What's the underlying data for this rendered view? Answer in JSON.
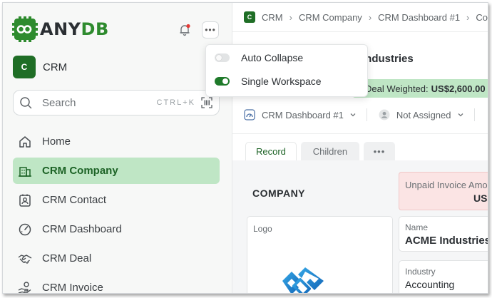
{
  "brand": {
    "name_prefix": "ANY",
    "name_suffix": "DB",
    "accent": "#2e8b2e"
  },
  "sidebar": {
    "workspace": {
      "initial": "C",
      "name": "CRM"
    },
    "search": {
      "placeholder": "Search",
      "shortcut": "CTRL+K"
    },
    "items": [
      {
        "label": "Home",
        "icon": "home-icon",
        "active": false
      },
      {
        "label": "CRM Company",
        "icon": "building-icon",
        "active": true
      },
      {
        "label": "CRM Contact",
        "icon": "contact-card-icon",
        "active": false
      },
      {
        "label": "CRM Dashboard",
        "icon": "gauge-icon",
        "active": false
      },
      {
        "label": "CRM Deal",
        "icon": "handshake-icon",
        "active": false
      },
      {
        "label": "CRM Invoice",
        "icon": "hand-coin-icon",
        "active": false
      }
    ]
  },
  "dropdown": {
    "items": [
      {
        "label": "Auto Collapse",
        "enabled": false
      },
      {
        "label": "Single Workspace",
        "enabled": true
      }
    ]
  },
  "main": {
    "breadcrumb": {
      "icon_initial": "C",
      "items": [
        "CRM",
        "CRM Company",
        "CRM Dashboard #1",
        "Com"
      ]
    },
    "title": "Industries",
    "deal_weighted": {
      "label": "Deal Weighted:",
      "value": "US$2,600.00"
    },
    "filters": {
      "dashboard": "CRM Dashboard #1",
      "assignee": "Not Assigned"
    },
    "tabs": {
      "record": "Record",
      "children": "Children",
      "more": "•••"
    },
    "section_title": "COMPANY",
    "unpaid": {
      "label": "Unpaid Invoice Amou",
      "value": "US$"
    },
    "logo_label": "Logo",
    "fields": {
      "name": {
        "label": "Name",
        "value": "ACME Industries"
      },
      "industry": {
        "label": "Industry",
        "value": "Accounting"
      }
    }
  }
}
